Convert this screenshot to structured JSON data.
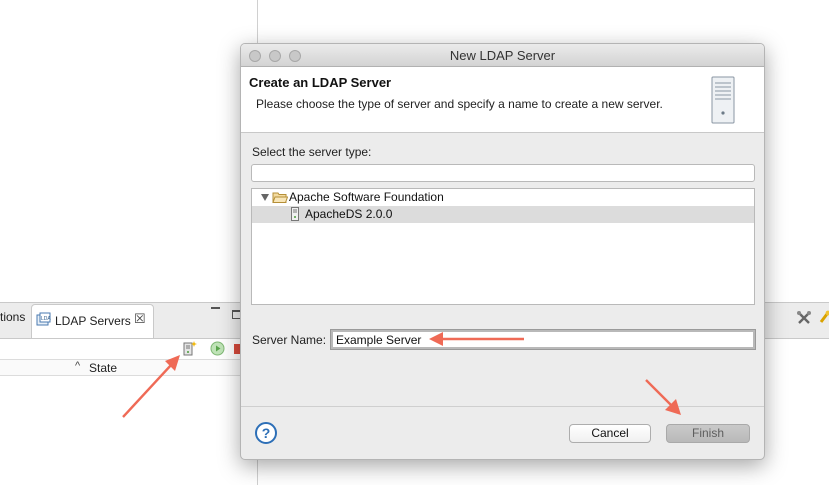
{
  "background": {
    "partial_tab_label": "tions",
    "active_tab_label": "LDAP Servers",
    "close_glyph": "☒",
    "column_sort_glyph": "^",
    "state_column_label": "State"
  },
  "dialog": {
    "title": "New LDAP Server",
    "banner": {
      "title": "Create an LDAP Server",
      "description": "Please choose the type of server and specify a name to create a new server."
    },
    "server_type_label": "Select the server type:",
    "filter_value": "",
    "tree": {
      "vendor": "Apache Software Foundation",
      "server": "ApacheDS 2.0.0"
    },
    "server_name_label": "Server Name:",
    "server_name_value": "Example Server",
    "help_glyph": "?",
    "cancel_label": "Cancel",
    "finish_label": "Finish"
  },
  "colors": {
    "annotation_arrow": "#ef6a56",
    "help_icon": "#2d6fb7",
    "selection": "#dcdcdc"
  }
}
